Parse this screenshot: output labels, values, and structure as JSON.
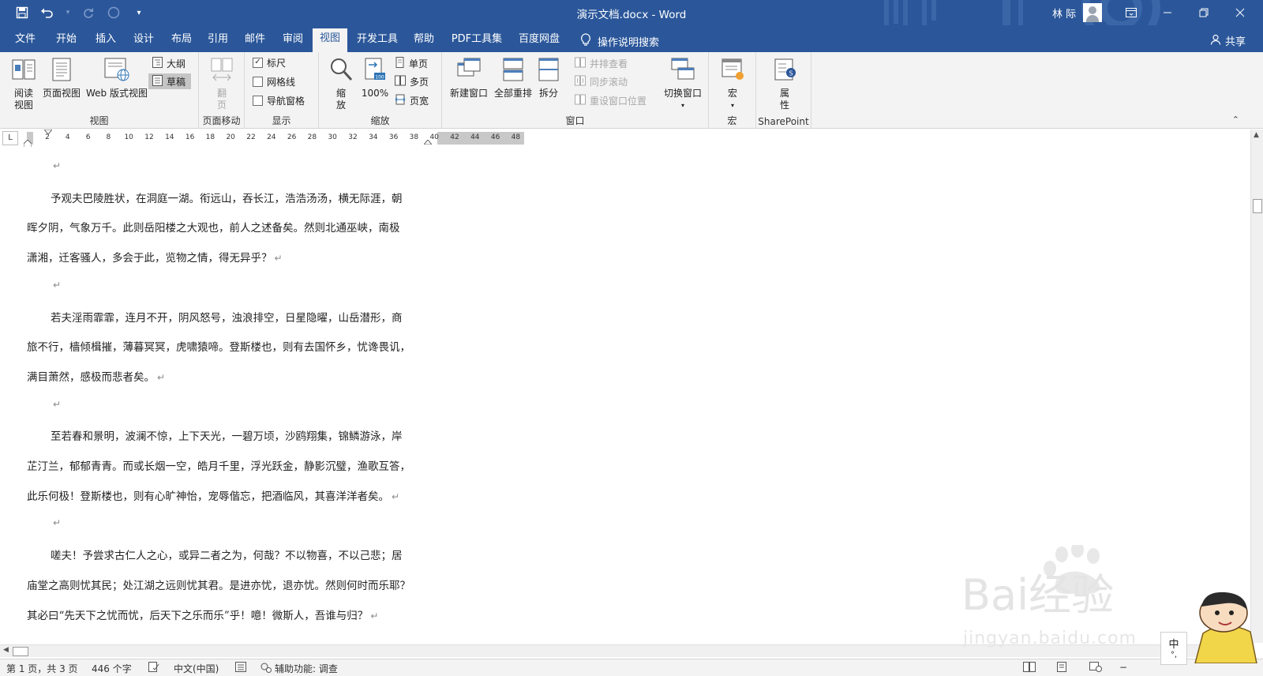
{
  "titlebar": {
    "doc_title": "演示文档.docx - Word",
    "user": "林 际",
    "qat": {
      "save_icon": "save-icon",
      "undo_icon": "undo-icon",
      "redo_icon": "redo-icon",
      "touch_icon": "touch-mode-icon",
      "customize_icon": "customize-qat-icon"
    },
    "window_controls": {
      "ribbon_display": "ribbon-display-options-icon",
      "minimize": "minimize-icon",
      "restore": "restore-icon",
      "close": "close-icon"
    }
  },
  "tabs": [
    {
      "label": "文件"
    },
    {
      "label": "开始"
    },
    {
      "label": "插入"
    },
    {
      "label": "设计"
    },
    {
      "label": "布局"
    },
    {
      "label": "引用"
    },
    {
      "label": "邮件"
    },
    {
      "label": "审阅"
    },
    {
      "label": "视图",
      "active": true
    },
    {
      "label": "开发工具"
    },
    {
      "label": "帮助"
    },
    {
      "label": "PDF工具集"
    },
    {
      "label": "百度网盘"
    }
  ],
  "tell_me": "操作说明搜索",
  "share": "共享",
  "ribbon": {
    "views": {
      "label": "视图",
      "read_mode": "阅读\n视图",
      "read_mode_l1": "阅读",
      "read_mode_l2": "视图",
      "print_layout": "页面视图",
      "web_layout": "Web 版式视图",
      "outline": "大纲",
      "draft": "草稿"
    },
    "page_movement": {
      "label": "页面移动",
      "flip_l1": "翻",
      "flip_l2": "页"
    },
    "show": {
      "label": "显示",
      "ruler": "标尺",
      "ruler_checked": true,
      "gridlines": "网格线",
      "gridlines_checked": false,
      "nav_pane": "导航窗格",
      "nav_pane_checked": false
    },
    "zoom": {
      "label": "缩放",
      "zoom_l1": "缩",
      "zoom_l2": "放",
      "zoom100": "100%",
      "one_page": "单页",
      "multi_page": "多页",
      "page_width": "页宽"
    },
    "window": {
      "label": "窗口",
      "new_window": "新建窗口",
      "arrange_all": "全部重排",
      "split": "拆分",
      "side_by_side": "并排查看",
      "sync_scroll": "同步滚动",
      "reset_pos": "重设窗口位置",
      "switch_windows": "切换窗口"
    },
    "macros": {
      "label": "宏",
      "macros": "宏"
    },
    "sharepoint": {
      "label": "SharePoint",
      "props_l1": "属",
      "props_l2": "性"
    }
  },
  "ruler": {
    "tab_selector": "L",
    "numbers": [
      "2",
      "4",
      "6",
      "8",
      "10",
      "12",
      "14",
      "16",
      "18",
      "20",
      "22",
      "24",
      "26",
      "28",
      "30",
      "32",
      "34",
      "36",
      "38",
      "40",
      "42",
      "44",
      "46",
      "48"
    ]
  },
  "document": {
    "paragraph_mark": "↵",
    "lines": [
      {
        "text": "",
        "indent": true,
        "mark": true
      },
      {
        "text": "予观夫巴陵胜状，在洞庭一湖。衔远山，吞长江，浩浩汤汤，横无际涯，朝",
        "indent": true,
        "mark": false
      },
      {
        "text": "晖夕阴，气象万千。此则岳阳楼之大观也，前人之述备矣。然则北通巫峡，南极",
        "indent": false,
        "mark": false
      },
      {
        "text": "潇湘，迁客骚人，多会于此，览物之情，得无异乎？",
        "indent": false,
        "mark": true
      },
      {
        "text": "",
        "indent": true,
        "mark": true
      },
      {
        "text": "若夫淫雨霏霏，连月不开，阴风怒号，浊浪排空，日星隐曜，山岳潜形，商",
        "indent": true,
        "mark": false
      },
      {
        "text": "旅不行，樯倾楫摧，薄暮冥冥，虎啸猿啼。登斯楼也，则有去国怀乡，忧谗畏讥，",
        "indent": false,
        "mark": false
      },
      {
        "text": "满目萧然，感极而悲者矣。",
        "indent": false,
        "mark": true
      },
      {
        "text": "",
        "indent": true,
        "mark": true
      },
      {
        "text": "至若春和景明，波澜不惊，上下天光，一碧万顷，沙鸥翔集，锦鳞游泳，岸",
        "indent": true,
        "mark": false
      },
      {
        "text": "芷汀兰，郁郁青青。而或长烟一空，皓月千里，浮光跃金，静影沉璧，渔歌互答，",
        "indent": false,
        "mark": false
      },
      {
        "text": "此乐何极！登斯楼也，则有心旷神怡，宠辱偕忘，把酒临风，其喜洋洋者矣。",
        "indent": false,
        "mark": true
      },
      {
        "text": "",
        "indent": true,
        "mark": true
      },
      {
        "text": "嗟夫！予尝求古仁人之心，或异二者之为，何哉？不以物喜，不以己悲；居",
        "indent": true,
        "mark": false
      },
      {
        "text": "庙堂之高则忧其民；处江湖之远则忧其君。是进亦忧，退亦忧。然则何时而乐耶？",
        "indent": false,
        "mark": false
      },
      {
        "text": "其必曰“先天下之忧而忧，后天下之乐而乐”乎！噫！微斯人，吾谁与归？",
        "indent": false,
        "mark": true
      }
    ]
  },
  "statusbar": {
    "page": "第 1 页，共 3 页",
    "words": "446 个字",
    "language": "中文(中国)",
    "accessibility": "辅助功能: 调查"
  },
  "watermark": {
    "logo": "Bai经验",
    "url": "jingyan.baidu.com"
  },
  "ime": {
    "label": "中",
    "sub": "°,"
  },
  "colors": {
    "title_bar": "#2b579a",
    "ribbon_bg": "#f3f3f3",
    "active_tab_text": "#2b579a"
  }
}
